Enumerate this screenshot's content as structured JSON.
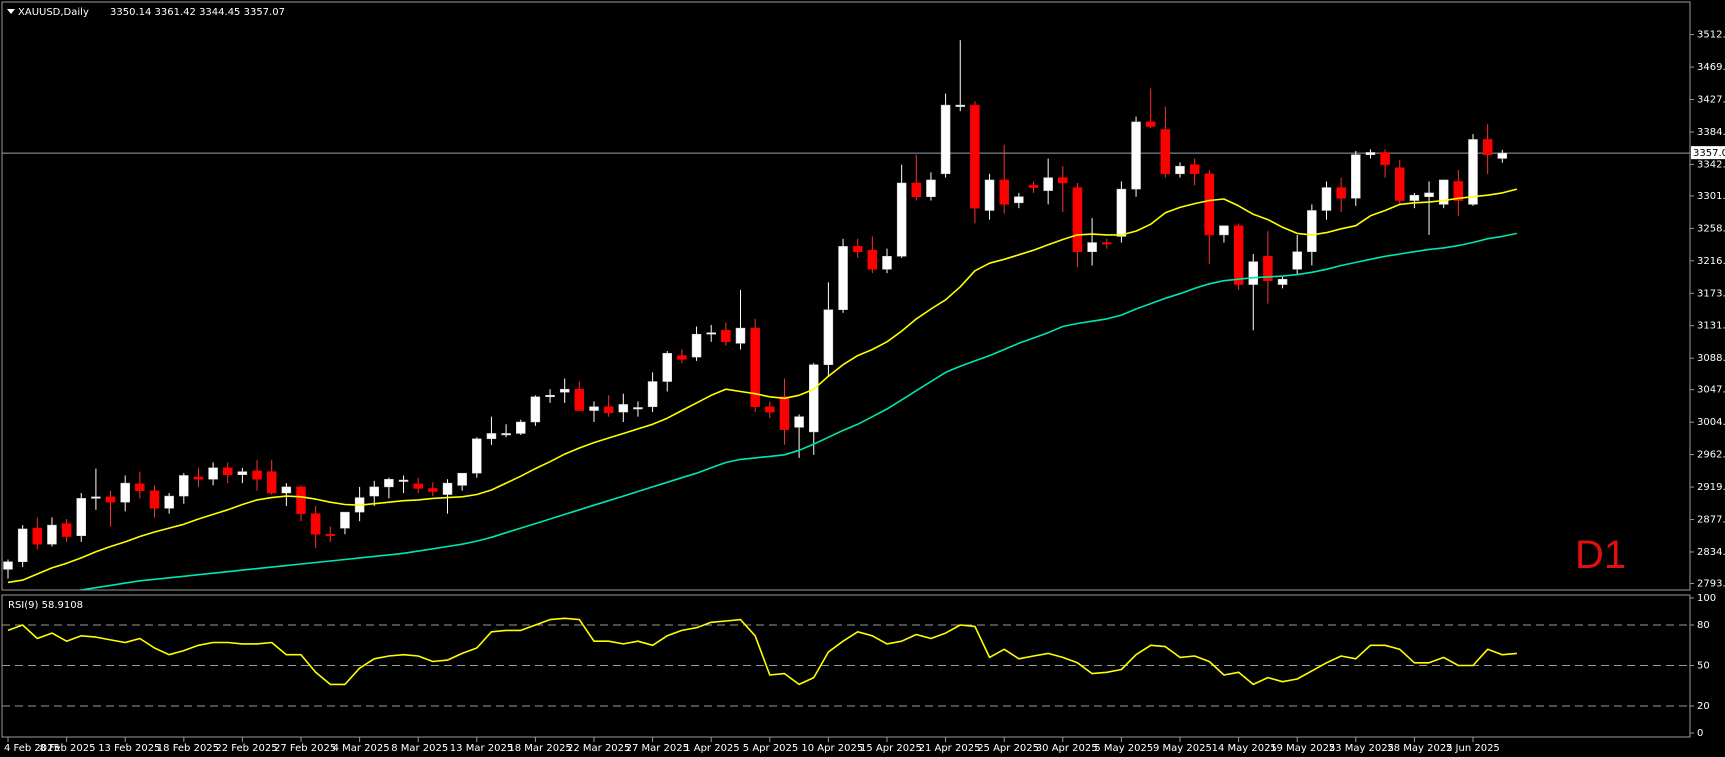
{
  "chart_data": {
    "type": "candlestick",
    "symbol_line": "XAUUSD,Daily",
    "ohlc_text": "3350.14 3361.42 3344.45 3357.07",
    "timeframe": "D1",
    "last_price_label": "3357.07",
    "price_axis": {
      "ylim": [
        2793.55,
        3530.0
      ],
      "tick_labels": [
        "3512.30",
        "3469.80",
        "3427.30",
        "3384.80",
        "3342.30",
        "3301.05",
        "3258.55",
        "3216.05",
        "3173.55",
        "3131.05",
        "3088.55",
        "3047.30",
        "3004.80",
        "2962.30",
        "2919.80",
        "2877.30",
        "2834.80",
        "2793.55"
      ],
      "current_price": 3357.07
    },
    "date_labels": [
      {
        "label": "4 Feb 2025",
        "index": 0
      },
      {
        "label": "8 Feb 2025",
        "index": 4
      },
      {
        "label": "13 Feb 2025",
        "index": 8
      },
      {
        "label": "18 Feb 2025",
        "index": 12
      },
      {
        "label": "22 Feb 2025",
        "index": 16
      },
      {
        "label": "27 Feb 2025",
        "index": 20
      },
      {
        "label": "4 Mar 2025",
        "index": 24
      },
      {
        "label": "8 Mar 2025",
        "index": 28
      },
      {
        "label": "13 Mar 2025",
        "index": 32
      },
      {
        "label": "18 Mar 2025",
        "index": 36
      },
      {
        "label": "22 Mar 2025",
        "index": 40
      },
      {
        "label": "27 Mar 2025",
        "index": 44
      },
      {
        "label": "1 Apr 2025",
        "index": 48
      },
      {
        "label": "5 Apr 2025",
        "index": 52
      },
      {
        "label": "10 Apr 2025",
        "index": 56
      },
      {
        "label": "15 Apr 2025",
        "index": 60
      },
      {
        "label": "21 Apr 2025",
        "index": 64
      },
      {
        "label": "25 Apr 2025",
        "index": 68
      },
      {
        "label": "30 Apr 2025",
        "index": 72
      },
      {
        "label": "5 May 2025",
        "index": 76
      },
      {
        "label": "9 May 2025",
        "index": 80
      },
      {
        "label": "14 May 2025",
        "index": 84
      },
      {
        "label": "19 May 2025",
        "index": 88
      },
      {
        "label": "23 May 2025",
        "index": 92
      },
      {
        "label": "28 May 2025",
        "index": 96
      },
      {
        "label": "2 Jun 2025",
        "index": 100
      }
    ],
    "candles": [
      [
        2812,
        2825,
        2800,
        2822
      ],
      [
        2822,
        2870,
        2815,
        2865
      ],
      [
        2866,
        2880,
        2838,
        2845
      ],
      [
        2845,
        2880,
        2842,
        2870
      ],
      [
        2872,
        2878,
        2848,
        2855
      ],
      [
        2856,
        2912,
        2848,
        2905
      ],
      [
        2905,
        2944,
        2890,
        2907
      ],
      [
        2907,
        2915,
        2868,
        2900
      ],
      [
        2900,
        2935,
        2888,
        2925
      ],
      [
        2924,
        2940,
        2905,
        2915
      ],
      [
        2915,
        2922,
        2880,
        2892
      ],
      [
        2892,
        2912,
        2885,
        2908
      ],
      [
        2908,
        2938,
        2898,
        2935
      ],
      [
        2933,
        2945,
        2920,
        2930
      ],
      [
        2930,
        2952,
        2922,
        2945
      ],
      [
        2945,
        2952,
        2925,
        2936
      ],
      [
        2936,
        2945,
        2925,
        2940
      ],
      [
        2941,
        2955,
        2915,
        2930
      ],
      [
        2940,
        2955,
        2910,
        2912
      ],
      [
        2912,
        2925,
        2895,
        2920
      ],
      [
        2920,
        2922,
        2875,
        2885
      ],
      [
        2885,
        2895,
        2840,
        2858
      ],
      [
        2858,
        2868,
        2848,
        2856
      ],
      [
        2866,
        2875,
        2858,
        2887
      ],
      [
        2887,
        2920,
        2875,
        2906
      ],
      [
        2908,
        2928,
        2895,
        2920
      ],
      [
        2920,
        2932,
        2905,
        2930
      ],
      [
        2928,
        2935,
        2912,
        2929
      ],
      [
        2924,
        2932,
        2912,
        2918
      ],
      [
        2918,
        2926,
        2908,
        2914
      ],
      [
        2910,
        2930,
        2885,
        2925
      ],
      [
        2922,
        2935,
        2915,
        2938
      ],
      [
        2938,
        2985,
        2932,
        2983
      ],
      [
        2983,
        3012,
        2975,
        2990
      ],
      [
        2990,
        3002,
        2985,
        2990
      ],
      [
        2990,
        3008,
        2988,
        3005
      ],
      [
        3005,
        3040,
        3000,
        3038
      ],
      [
        3038,
        3048,
        3030,
        3040
      ],
      [
        3044,
        3062,
        3030,
        3048
      ],
      [
        3048,
        3058,
        3025,
        3020
      ],
      [
        3020,
        3032,
        3005,
        3025
      ],
      [
        3025,
        3040,
        3012,
        3017
      ],
      [
        3018,
        3042,
        3005,
        3028
      ],
      [
        3022,
        3032,
        3012,
        3024
      ],
      [
        3025,
        3070,
        3018,
        3058
      ],
      [
        3058,
        3098,
        3045,
        3095
      ],
      [
        3092,
        3100,
        3082,
        3087
      ],
      [
        3090,
        3130,
        3085,
        3120
      ],
      [
        3120,
        3132,
        3110,
        3122
      ],
      [
        3125,
        3135,
        3105,
        3110
      ],
      [
        3108,
        3178,
        3100,
        3128
      ],
      [
        3128,
        3140,
        3018,
        3025
      ],
      [
        3025,
        3032,
        3010,
        3018
      ],
      [
        3038,
        3062,
        2975,
        2995
      ],
      [
        2998,
        3015,
        2958,
        3012
      ],
      [
        2992,
        3082,
        2962,
        3080
      ],
      [
        3080,
        3188,
        3065,
        3152
      ],
      [
        3152,
        3245,
        3148,
        3235
      ],
      [
        3235,
        3245,
        3220,
        3228
      ],
      [
        3230,
        3248,
        3200,
        3205
      ],
      [
        3205,
        3232,
        3200,
        3222
      ],
      [
        3222,
        3342,
        3220,
        3318
      ],
      [
        3318,
        3355,
        3295,
        3300
      ],
      [
        3300,
        3332,
        3295,
        3322
      ],
      [
        3330,
        3435,
        3325,
        3420
      ],
      [
        3420,
        3505,
        3412,
        3420
      ],
      [
        3420,
        3425,
        3265,
        3285
      ],
      [
        3282,
        3330,
        3270,
        3322
      ],
      [
        3322,
        3368,
        3278,
        3290
      ],
      [
        3292,
        3305,
        3285,
        3300
      ],
      [
        3315,
        3320,
        3305,
        3312
      ],
      [
        3308,
        3350,
        3290,
        3325
      ],
      [
        3325,
        3340,
        3280,
        3318
      ],
      [
        3312,
        3318,
        3208,
        3228
      ],
      [
        3228,
        3272,
        3210,
        3240
      ],
      [
        3240,
        3245,
        3232,
        3238
      ],
      [
        3248,
        3320,
        3240,
        3310
      ],
      [
        3310,
        3405,
        3300,
        3398
      ],
      [
        3398,
        3442,
        3390,
        3392
      ],
      [
        3388,
        3418,
        3325,
        3330
      ],
      [
        3330,
        3345,
        3325,
        3340
      ],
      [
        3342,
        3350,
        3315,
        3330
      ],
      [
        3330,
        3335,
        3212,
        3250
      ],
      [
        3250,
        3262,
        3240,
        3262
      ],
      [
        3262,
        3265,
        3178,
        3185
      ],
      [
        3185,
        3225,
        3125,
        3215
      ],
      [
        3222,
        3255,
        3160,
        3190
      ],
      [
        3185,
        3195,
        3180,
        3192
      ],
      [
        3205,
        3250,
        3198,
        3228
      ],
      [
        3228,
        3290,
        3210,
        3282
      ],
      [
        3282,
        3320,
        3270,
        3312
      ],
      [
        3312,
        3325,
        3280,
        3298
      ],
      [
        3298,
        3360,
        3288,
        3355
      ],
      [
        3355,
        3362,
        3350,
        3358
      ],
      [
        3358,
        3362,
        3325,
        3342
      ],
      [
        3338,
        3348,
        3290,
        3295
      ],
      [
        3295,
        3305,
        3285,
        3302
      ],
      [
        3300,
        3320,
        3250,
        3305
      ],
      [
        3290,
        3315,
        3285,
        3322
      ],
      [
        3320,
        3335,
        3275,
        3295
      ],
      [
        3290,
        3382,
        3288,
        3375
      ],
      [
        3375,
        3395,
        3330,
        3355
      ],
      [
        3350.14,
        3361.42,
        3344.45,
        3357.07
      ]
    ],
    "ma_fast": [
      2795,
      2798,
      2806,
      2814,
      2820,
      2827,
      2835,
      2842,
      2848,
      2855,
      2861,
      2866,
      2871,
      2878,
      2884,
      2890,
      2897,
      2903,
      2906,
      2908,
      2907,
      2904,
      2900,
      2897,
      2896,
      2898,
      2900,
      2902,
      2903,
      2905,
      2906,
      2907,
      2910,
      2916,
      2925,
      2934,
      2944,
      2953,
      2963,
      2971,
      2978,
      2984,
      2990,
      2996,
      3002,
      3010,
      3020,
      3030,
      3040,
      3048,
      3045,
      3042,
      3038,
      3036,
      3040,
      3048,
      3065,
      3080,
      3092,
      3100,
      3110,
      3124,
      3140,
      3153,
      3165,
      3182,
      3203,
      3213,
      3218,
      3224,
      3230,
      3237,
      3244,
      3250,
      3251,
      3250,
      3250,
      3255,
      3264,
      3279,
      3286,
      3291,
      3295,
      3297,
      3288,
      3277,
      3270,
      3260,
      3252,
      3250,
      3253,
      3258,
      3262,
      3275,
      3282,
      3290,
      3292,
      3293,
      3295,
      3298,
      3300,
      3302,
      3305,
      3310
    ],
    "ma_slow": [
      2770,
      2773,
      2776,
      2779,
      2782,
      2785,
      2788,
      2791,
      2794,
      2797,
      2799,
      2801,
      2803,
      2805,
      2807,
      2809,
      2811,
      2813,
      2815,
      2817,
      2819,
      2821,
      2823,
      2825,
      2827,
      2829,
      2831,
      2833,
      2836,
      2839,
      2842,
      2845,
      2849,
      2854,
      2860,
      2866,
      2872,
      2878,
      2884,
      2890,
      2896,
      2902,
      2908,
      2914,
      2920,
      2926,
      2932,
      2938,
      2945,
      2952,
      2956,
      2958,
      2960,
      2962,
      2968,
      2976,
      2985,
      2994,
      3002,
      3012,
      3022,
      3034,
      3046,
      3058,
      3070,
      3078,
      3085,
      3092,
      3100,
      3108,
      3115,
      3122,
      3130,
      3134,
      3137,
      3140,
      3145,
      3153,
      3160,
      3167,
      3173,
      3180,
      3186,
      3190,
      3192,
      3194,
      3195,
      3196,
      3198,
      3201,
      3205,
      3210,
      3214,
      3218,
      3222,
      3225,
      3228,
      3231,
      3233,
      3236,
      3240,
      3245,
      3248,
      3252
    ],
    "rsi": {
      "label": "RSI(9) 58.9108",
      "period": 9,
      "last_value": 58.9108,
      "ylim": [
        0,
        100
      ],
      "tick_labels": [
        "100",
        "80",
        "50",
        "20",
        "0"
      ],
      "levels": [
        80,
        50,
        20
      ],
      "values": [
        76,
        80,
        70,
        74,
        68,
        72,
        71,
        69,
        67,
        70,
        63,
        58,
        61,
        65,
        67,
        67,
        66,
        66,
        67,
        58,
        58,
        45,
        36,
        36,
        48,
        55,
        57,
        58,
        57,
        53,
        54,
        59,
        63,
        75,
        76,
        76,
        80,
        84,
        85,
        84,
        68,
        68,
        66,
        68,
        65,
        72,
        76,
        78,
        82,
        83,
        84,
        72,
        43,
        44,
        36,
        41,
        60,
        68,
        75,
        72,
        66,
        68,
        73,
        70,
        74,
        80,
        79,
        56,
        62,
        55,
        57,
        59,
        56,
        52,
        44,
        45,
        47,
        58,
        65,
        64,
        56,
        57,
        53,
        43,
        45,
        36,
        41,
        38,
        40,
        46,
        52,
        57,
        55,
        65,
        65,
        62,
        52,
        52,
        56,
        50,
        50,
        62,
        58,
        59
      ]
    },
    "colors": {
      "background": "#000000",
      "bull_candle": "#ffffff",
      "bear_candle": "#ff0000",
      "ma_fast": "#ffff00",
      "ma_slow": "#00e6b0",
      "rsi_line": "#ffff00",
      "grid_level": "#9a9a9a",
      "current_price_line": "#8fa3b8"
    }
  }
}
